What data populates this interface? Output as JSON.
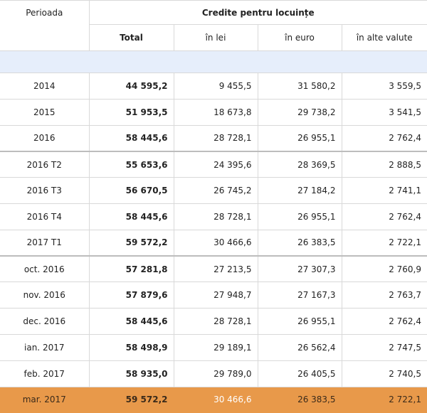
{
  "header": {
    "period_label": "Perioada",
    "group_label": "Credite pentru locuințe",
    "columns": [
      "Total",
      "în lei",
      "în euro",
      "în alte valute"
    ]
  },
  "rows": [
    {
      "period": "2014",
      "total": "44 595,2",
      "lei": "9 455,5",
      "euro": "31 580,2",
      "alte": "3 559,5"
    },
    {
      "period": "2015",
      "total": "51 953,5",
      "lei": "18 673,8",
      "euro": "29 738,2",
      "alte": "3 541,5"
    },
    {
      "period": "2016",
      "total": "58 445,6",
      "lei": "28 728,1",
      "euro": "26 955,1",
      "alte": "2 762,4"
    },
    {
      "period": "2016 T2",
      "total": "55 653,6",
      "lei": "24 395,6",
      "euro": "28 369,5",
      "alte": "2 888,5"
    },
    {
      "period": "2016 T3",
      "total": "56 670,5",
      "lei": "26 745,2",
      "euro": "27 184,2",
      "alte": "2 741,1"
    },
    {
      "period": "2016 T4",
      "total": "58 445,6",
      "lei": "28 728,1",
      "euro": "26 955,1",
      "alte": "2 762,4"
    },
    {
      "period": "2017 T1",
      "total": "59 572,2",
      "lei": "30 466,6",
      "euro": "26 383,5",
      "alte": "2 722,1"
    },
    {
      "period": "oct. 2016",
      "total": "57 281,8",
      "lei": "27 213,5",
      "euro": "27 307,3",
      "alte": "2 760,9"
    },
    {
      "period": "nov. 2016",
      "total": "57 879,6",
      "lei": "27 948,7",
      "euro": "27 167,3",
      "alte": "2 763,7"
    },
    {
      "period": "dec. 2016",
      "total": "58 445,6",
      "lei": "28 728,1",
      "euro": "26 955,1",
      "alte": "2 762,4"
    },
    {
      "period": "ian. 2017",
      "total": "58 498,9",
      "lei": "29 189,1",
      "euro": "26 562,4",
      "alte": "2 747,5"
    },
    {
      "period": "feb. 2017",
      "total": "58 935,0",
      "lei": "29 789,0",
      "euro": "26 405,5",
      "alte": "2 740,5"
    },
    {
      "period": "mar. 2017",
      "total": "59 572,2",
      "lei": "30 466,6",
      "euro": "26 383,5",
      "alte": "2 722,1"
    }
  ],
  "colors": {
    "highlight_row": "#e8994a",
    "spacer_band": "#e6eefb",
    "gridline": "#d9d9d9"
  }
}
